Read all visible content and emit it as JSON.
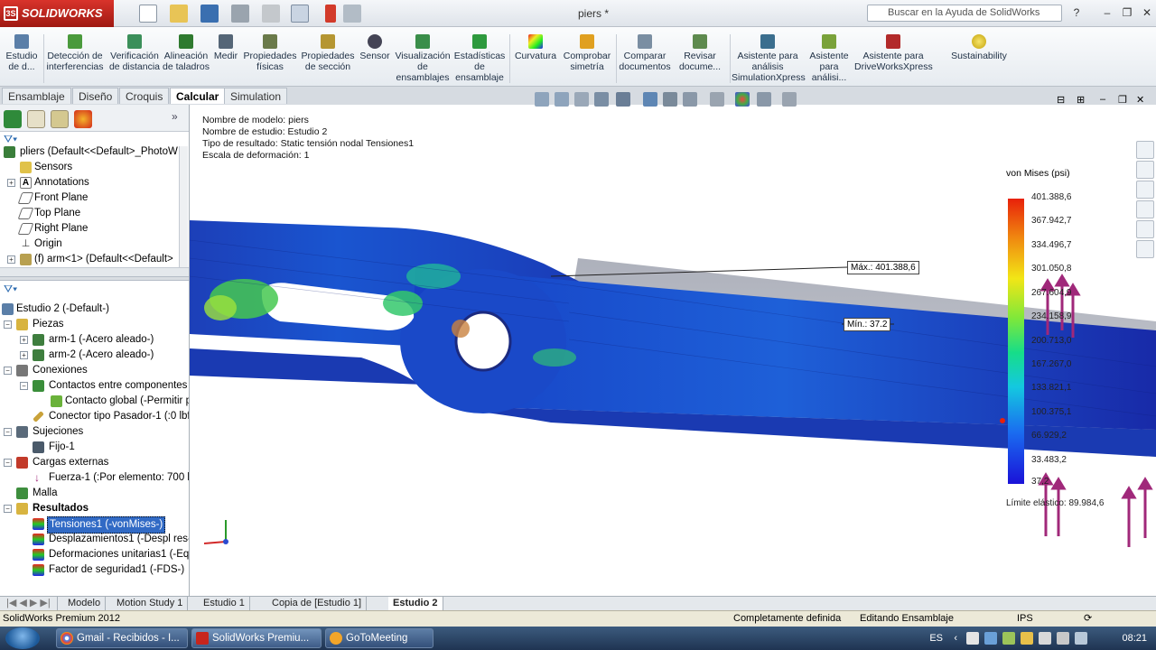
{
  "titlebar": {
    "app_name": "SOLIDWORKS",
    "document_title": "piers *",
    "help_search_placeholder": "Buscar en la Ayuda de SolidWorks"
  },
  "ribbon": {
    "buttons": [
      {
        "label": "Estudio de d...",
        "icon": "study-icon"
      },
      {
        "label": "Detección de interferencias",
        "icon": "interference-icon"
      },
      {
        "label": "Verificación de distancia",
        "icon": "distance-check-icon"
      },
      {
        "label": "Alineación de taladros",
        "icon": "hole-alignment-icon"
      },
      {
        "label": "Medir",
        "icon": "measure-icon"
      },
      {
        "label": "Propiedades físicas",
        "icon": "mass-properties-icon"
      },
      {
        "label": "Propiedades de sección",
        "icon": "section-properties-icon"
      },
      {
        "label": "Sensor",
        "icon": "sensor-icon"
      },
      {
        "label": "Visualización de ensamblajes",
        "icon": "assembly-visualization-icon"
      },
      {
        "label": "Estadísticas de ensamblaje",
        "icon": "assembly-statistics-icon"
      },
      {
        "label": "Curvatura",
        "icon": "curvature-icon"
      },
      {
        "label": "Comprobar simetría",
        "icon": "symmetry-check-icon"
      },
      {
        "label": "Comparar documentos",
        "icon": "compare-documents-icon"
      },
      {
        "label": "Revisar docume...",
        "icon": "check-document-icon"
      },
      {
        "label": "Asistente para análisis SimulationXpress",
        "icon": "simulationxpress-icon"
      },
      {
        "label": "Asistente para análisi...",
        "icon": "floxpress-icon"
      },
      {
        "label": "Asistente para DriveWorksXpress",
        "icon": "driveworksxpress-icon"
      },
      {
        "label": "Sustainability",
        "icon": "sustainability-icon"
      }
    ]
  },
  "command_tabs": [
    "Ensamblaje",
    "Diseño",
    "Croquis",
    "Calcular",
    "Simulation"
  ],
  "active_command_tab": "Calcular",
  "feature_tree": {
    "root": "pliers  (Default<<Default>_PhotoW",
    "items": [
      "Sensors",
      "Annotations",
      "Front Plane",
      "Top Plane",
      "Right Plane",
      "Origin",
      "(f) arm<1> (Default<<Default>"
    ]
  },
  "simulation_tree": {
    "root": "Estudio 2 (-Default-)",
    "items": [
      "Piezas",
      "arm-1 (-Acero aleado-)",
      "arm-2 (-Acero aleado-)",
      "Conexiones",
      "Contactos entre componentes",
      "Contacto global (-Permitir p",
      "Conector tipo Pasador-1 (:0 lbf",
      "Sujeciones",
      "Fijo-1",
      "Cargas externas",
      "Fuerza-1 (:Por elemento: 700 lb",
      "Malla",
      "Resultados",
      "Tensiones1 (-vonMises-)",
      "Desplazamientos1 (-Despl res-)",
      "Deformaciones unitarias1 (-Equ",
      "Factor de seguridad1 (-FDS-)"
    ]
  },
  "viewport": {
    "info": [
      "Nombre de modelo: piers",
      "Nombre de estudio: Estudio 2",
      "Tipo de resultado: Static tensión nodal Tensiones1",
      "Escala de deformación: 1"
    ],
    "legend_title": "von Mises (psi)",
    "legend_values": [
      "401.388,6",
      "367.942,7",
      "334.496,7",
      "301.050,8",
      "267.604,9",
      "234.158,9",
      "200.713,0",
      "167.267,0",
      "133.821,1",
      "100.375,1",
      "66.929,2",
      "33.483,2",
      "37,2"
    ],
    "max_label": "Máx.:",
    "max_value": "401.388,6",
    "min_label": "Mín.:",
    "min_value": "37.2",
    "yield_label": "Límite elástico: 89.984,6",
    "colors": {
      "stress_low": "#1a12d8",
      "stress_mid": "#16dd89",
      "stress_high": "#e8210a",
      "load_arrow": "#a0287a"
    }
  },
  "bottom_tabs": [
    "Modelo",
    "Motion Study 1",
    "Estudio 1",
    "Copia de [Estudio 1]",
    "Estudio 2"
  ],
  "active_bottom_tab": "Estudio 2",
  "statusbar": {
    "product": "SolidWorks Premium 2012",
    "definition": "Completamente definida",
    "mode": "Editando Ensamblaje",
    "units": "IPS"
  },
  "taskbar": {
    "tasks": [
      {
        "label": "Gmail - Recibidos - I...",
        "icon": "chrome-icon"
      },
      {
        "label": "SolidWorks Premiu...",
        "icon": "solidworks-icon"
      },
      {
        "label": "GoToMeeting",
        "icon": "gotomeeting-icon"
      }
    ],
    "language": "ES",
    "clock": "08:21 p.m."
  }
}
